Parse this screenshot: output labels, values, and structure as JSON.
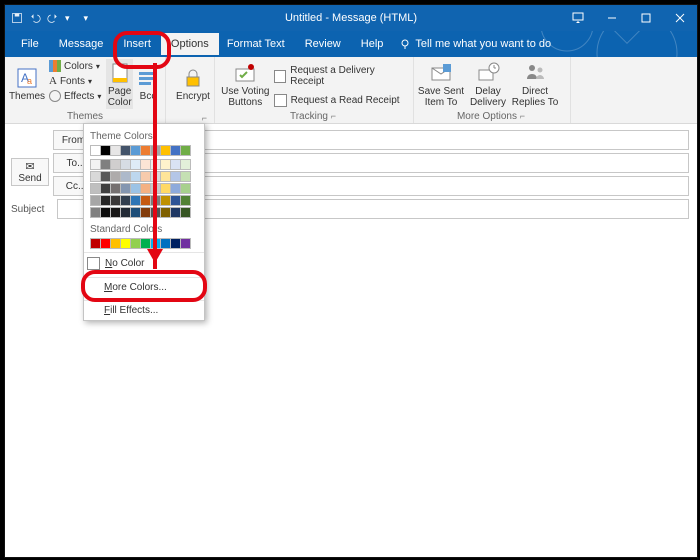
{
  "titlebar": {
    "title": "Untitled - Message (HTML)"
  },
  "menu": {
    "file": "File",
    "message": "Message",
    "insert": "Insert",
    "options": "Options",
    "formatText": "Format Text",
    "review": "Review",
    "help": "Help",
    "tellme": "Tell me what you want to do"
  },
  "ribbon": {
    "themes": {
      "label": "Themes",
      "themesBtn": "Themes",
      "colors": "Colors",
      "fonts": "Fonts",
      "effects": "Effects",
      "pageColor": "Page\nColor",
      "bcc": "Bcc"
    },
    "encrypt": {
      "btn": "Encrypt"
    },
    "tracking": {
      "label": "Tracking",
      "voting": "Use Voting\nButtons",
      "reqDelivery": "Request a Delivery Receipt",
      "reqRead": "Request a Read Receipt"
    },
    "more": {
      "label": "More Options",
      "saveSent": "Save Sent\nItem To",
      "delay": "Delay\nDelivery",
      "direct": "Direct\nReplies To"
    }
  },
  "compose": {
    "from": "From",
    "to": "To...",
    "cc": "Cc...",
    "subject": "Subject",
    "send": "Send"
  },
  "popup": {
    "themeColors": "Theme Colors",
    "standardColors": "Standard Colors",
    "noColor": "No Color",
    "moreColors": "More Colors...",
    "fillEffects": "Fill Effects..."
  },
  "themeRow": [
    "#ffffff",
    "#000000",
    "#e7e6e6",
    "#44546a",
    "#5b9bd5",
    "#ed7d31",
    "#a5a5a5",
    "#ffc000",
    "#4472c4",
    "#70ad47"
  ],
  "themeShades": [
    [
      "#f2f2f2",
      "#808080",
      "#d0cece",
      "#d6dce4",
      "#deebf6",
      "#fbe5d5",
      "#ededed",
      "#fff2cc",
      "#d9e2f3",
      "#e2efd9"
    ],
    [
      "#d9d9d9",
      "#595959",
      "#aeabab",
      "#adb9ca",
      "#bdd7ee",
      "#f7cbac",
      "#dbdbdb",
      "#fee599",
      "#b4c6e7",
      "#c5e0b3"
    ],
    [
      "#bfbfbf",
      "#404040",
      "#757070",
      "#8496b0",
      "#9cc3e5",
      "#f4b183",
      "#c9c9c9",
      "#ffd965",
      "#8eaadb",
      "#a8d08d"
    ],
    [
      "#a6a6a6",
      "#262626",
      "#3a3838",
      "#323f4f",
      "#2e75b5",
      "#c55a11",
      "#7b7b7b",
      "#bf9000",
      "#2f5496",
      "#538135"
    ],
    [
      "#808080",
      "#0d0d0d",
      "#171616",
      "#222a35",
      "#1e4e79",
      "#833c0b",
      "#525252",
      "#7f6000",
      "#1f3864",
      "#375623"
    ]
  ],
  "standardColors": [
    "#c00000",
    "#ff0000",
    "#ffc000",
    "#ffff00",
    "#92d050",
    "#00b050",
    "#00b0f0",
    "#0070c0",
    "#002060",
    "#7030a0"
  ]
}
